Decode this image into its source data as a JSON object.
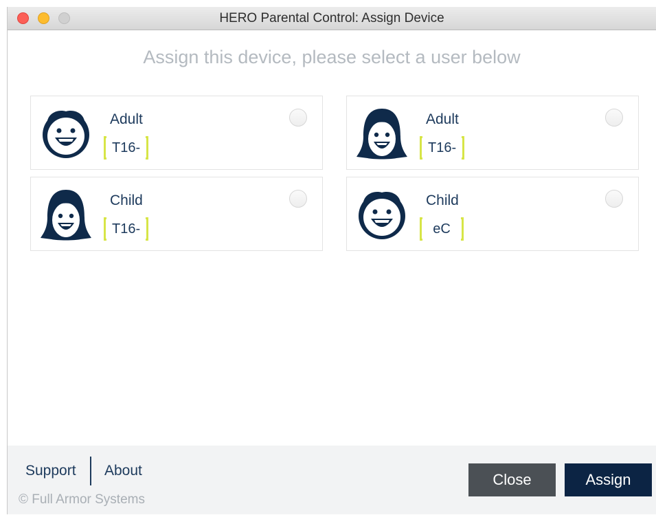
{
  "window": {
    "title": "HERO Parental Control: Assign Device"
  },
  "main": {
    "heading": "Assign this device, please select a user below",
    "users": [
      {
        "role": "Adult",
        "code": "T16-",
        "avatar": "boy-face-icon"
      },
      {
        "role": "Adult",
        "code": "T16-",
        "avatar": "girl-face-icon"
      },
      {
        "role": "Child",
        "code": "T16-",
        "avatar": "girl-face-icon"
      },
      {
        "role": "Child",
        "code": "eC",
        "avatar": "boy-face-icon"
      }
    ]
  },
  "footer": {
    "support_label": "Support",
    "about_label": "About",
    "copyright": "© Full Armor Systems",
    "close_label": "Close",
    "assign_label": "Assign"
  },
  "colors": {
    "navy": "#1d3a5c",
    "bracket_accent": "#d7e547",
    "assign_button": "#0c2444",
    "close_button": "#4b5055"
  }
}
